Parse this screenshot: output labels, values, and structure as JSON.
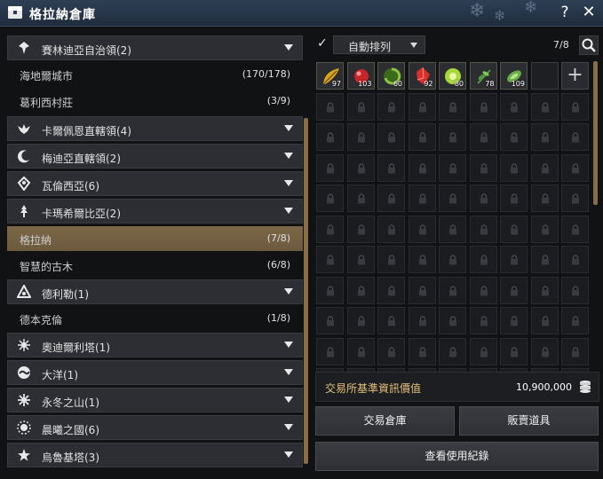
{
  "window": {
    "title": "格拉納倉庫",
    "icon": "chest-icon"
  },
  "regions": [
    {
      "type": "header",
      "label": "賽林迪亞自治領(2)",
      "icon": "region-emblem-icon"
    },
    {
      "type": "sub",
      "label": "海地爾城市",
      "count": "(170/178)"
    },
    {
      "type": "sub",
      "label": "葛利西村莊",
      "count": "(3/9)"
    },
    {
      "type": "header",
      "label": "卡爾佩恩直轄領(4)",
      "icon": "wings-emblem-icon"
    },
    {
      "type": "header",
      "label": "梅迪亞直轄領(2)",
      "icon": "crescent-emblem-icon"
    },
    {
      "type": "header",
      "label": "瓦倫西亞(6)",
      "icon": "diamond-emblem-icon"
    },
    {
      "type": "header",
      "label": "卡瑪希爾比亞(2)",
      "icon": "tree-emblem-icon"
    },
    {
      "type": "sub",
      "label": "格拉納",
      "count": "(7/8)",
      "active": true
    },
    {
      "type": "sub",
      "label": "智慧的古木",
      "count": "(6/8)"
    },
    {
      "type": "header",
      "label": "德利勒(1)",
      "icon": "triangle-emblem-icon"
    },
    {
      "type": "sub",
      "label": "德本克倫",
      "count": "(1/8)"
    },
    {
      "type": "header",
      "label": "奧迪爾利塔(1)",
      "icon": "leaf-emblem-icon"
    },
    {
      "type": "header",
      "label": "大洋(1)",
      "icon": "wave-emblem-icon"
    },
    {
      "type": "header",
      "label": "永冬之山(1)",
      "icon": "snowflake-emblem-icon"
    },
    {
      "type": "header",
      "label": "晨曦之國(6)",
      "icon": "sun-emblem-icon"
    },
    {
      "type": "header",
      "label": "烏魯基塔(3)",
      "icon": "star-emblem-icon"
    }
  ],
  "toolbar": {
    "auto_sort_checked": true,
    "auto_sort_label": "自動排列",
    "capacity": "7/8"
  },
  "items": [
    {
      "name": "golden-feather-item",
      "qty": "97",
      "color": "#d9a520"
    },
    {
      "name": "red-orb-item",
      "qty": "103",
      "color": "#c8262a"
    },
    {
      "name": "green-swirl-item",
      "qty": "60",
      "color": "#8bc53f"
    },
    {
      "name": "red-crystal-item",
      "qty": "92",
      "color": "#d8302c"
    },
    {
      "name": "lime-orb-item",
      "qty": "80",
      "color": "#a6d83a"
    },
    {
      "name": "herb-sprig-item",
      "qty": "78",
      "color": "#4f9a3a"
    },
    {
      "name": "green-pod-item",
      "qty": "109",
      "color": "#6aae4a"
    }
  ],
  "price": {
    "label": "交易所基準資訊價值",
    "value": "10,900,000"
  },
  "buttons": {
    "market_storage": "交易倉庫",
    "sell_items": "販賣道具",
    "view_log": "查看使用紀錄"
  }
}
